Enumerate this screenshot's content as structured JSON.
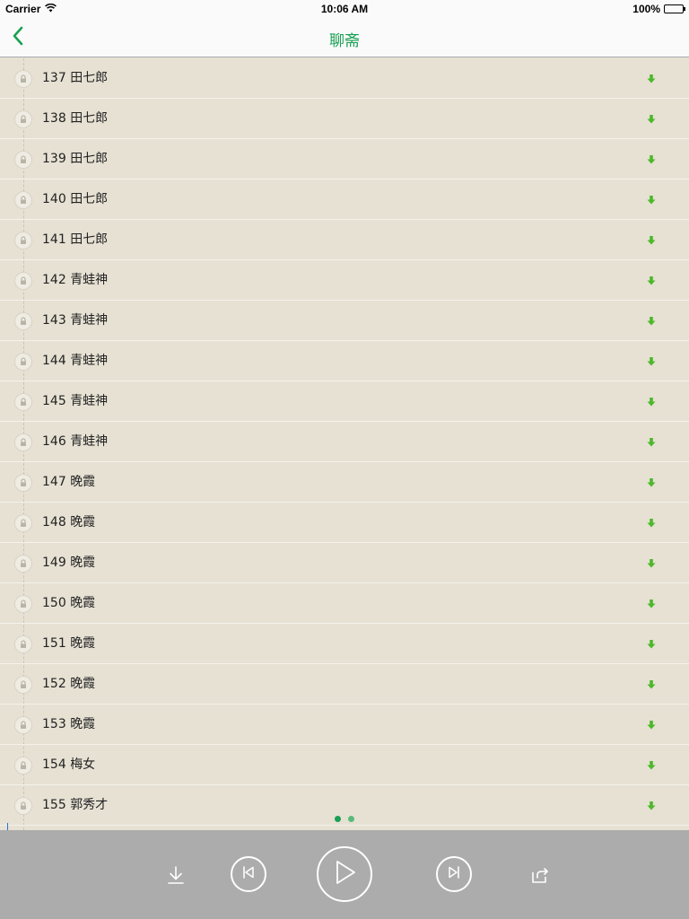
{
  "status_bar": {
    "carrier": "Carrier",
    "time": "10:06 AM",
    "battery": "100%"
  },
  "nav": {
    "title": "聊斋",
    "back_icon": "chevron-left-icon"
  },
  "colors": {
    "accent": "#1aa053",
    "download": "#4cb82a",
    "list_bg": "#e6e1d3",
    "player_bg": "#acacac"
  },
  "episodes": [
    {
      "number": "137",
      "title": "田七郎"
    },
    {
      "number": "138",
      "title": "田七郎"
    },
    {
      "number": "139",
      "title": "田七郎"
    },
    {
      "number": "140",
      "title": "田七郎"
    },
    {
      "number": "141",
      "title": "田七郎"
    },
    {
      "number": "142",
      "title": "青蛙神"
    },
    {
      "number": "143",
      "title": "青蛙神"
    },
    {
      "number": "144",
      "title": "青蛙神"
    },
    {
      "number": "145",
      "title": "青蛙神"
    },
    {
      "number": "146",
      "title": "青蛙神"
    },
    {
      "number": "147",
      "title": "晚霞"
    },
    {
      "number": "148",
      "title": "晚霞"
    },
    {
      "number": "149",
      "title": "晚霞"
    },
    {
      "number": "150",
      "title": "晚霞"
    },
    {
      "number": "151",
      "title": "晚霞"
    },
    {
      "number": "152",
      "title": "晚霞"
    },
    {
      "number": "153",
      "title": "晚霞"
    },
    {
      "number": "154",
      "title": "梅女"
    },
    {
      "number": "155",
      "title": "郭秀才"
    }
  ],
  "page_indicator": {
    "count": 2,
    "current": 1
  },
  "player": {
    "controls": [
      "download-icon",
      "previous-track-icon",
      "play-icon",
      "next-track-icon",
      "share-icon"
    ]
  }
}
